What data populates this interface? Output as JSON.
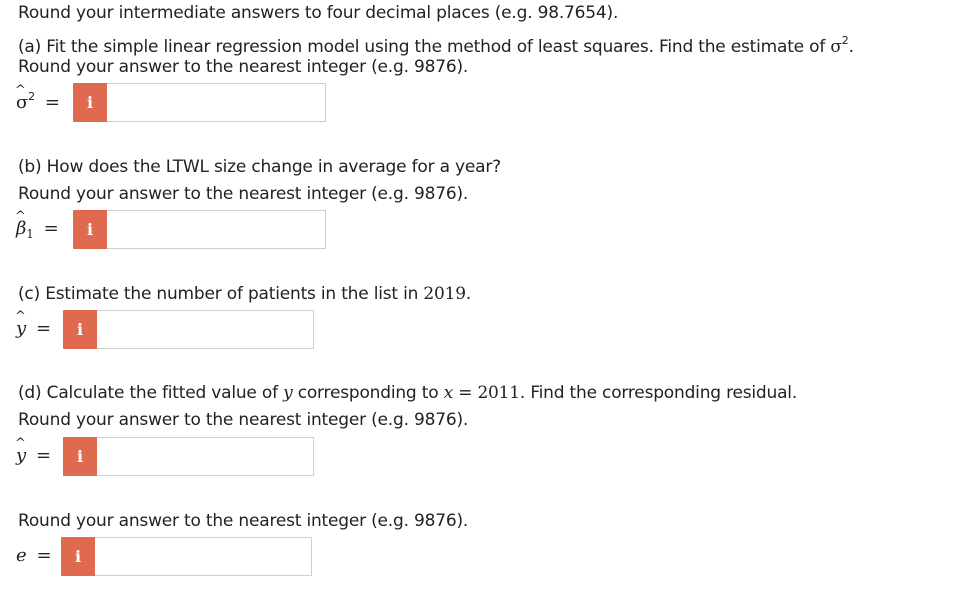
{
  "instructions": "Round your intermediate answers to four decimal places (e.g. 98.7654).",
  "part_a": {
    "prompt": "(a) Fit the simple linear regression model using the method of least squares. Find the estimate of ",
    "prompt_symbol": "σ",
    "prompt_sup": "2",
    "prompt_end": ".",
    "round_note": "Round your answer to the nearest integer (e.g. 9876).",
    "symbol": "σ",
    "symbol_sup": "2",
    "eq": "=",
    "info_label": "i",
    "value": ""
  },
  "part_b": {
    "prompt": "(b) How does the LTWL size change in average for a year?",
    "round_note": "Round your answer to the nearest integer (e.g. 9876).",
    "symbol": "β",
    "symbol_sub": "1",
    "eq": "=",
    "info_label": "i",
    "value": ""
  },
  "part_c": {
    "prompt": "(c) Estimate the number of patients in the list in ",
    "prompt_year": "2019",
    "prompt_end": ".",
    "symbol": "y",
    "eq": "=",
    "info_label": "i",
    "value": ""
  },
  "part_d": {
    "prompt_1": "(d) Calculate the fitted value of ",
    "var_y": "y",
    "prompt_2": " corresponding to ",
    "var_x": "x",
    "eq_sign": " = ",
    "x_value": "2011",
    "prompt_3": ". Find the corresponding residual.",
    "round_note": "Round your answer to the nearest integer (e.g. 9876).",
    "symbol": "y",
    "eq": "=",
    "info_label": "i",
    "value": ""
  },
  "part_e": {
    "round_note": "Round your answer to the nearest integer (e.g. 9876).",
    "symbol": "e",
    "eq": "=",
    "info_label": "i",
    "value": ""
  },
  "colors": {
    "info_button": "#e06a4f",
    "text": "#222222",
    "field_border": "#cfcfcf"
  },
  "icons": {
    "info": "info-icon"
  }
}
